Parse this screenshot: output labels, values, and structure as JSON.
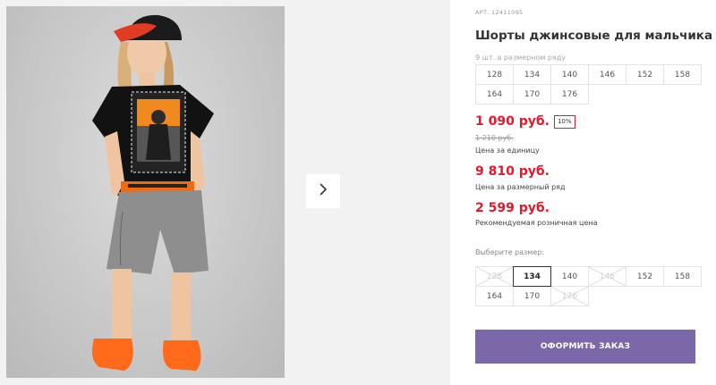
{
  "product": {
    "sku": "АРТ. 12411095",
    "title": "Шорты джинсовые для мальчика",
    "pack_note": "9 шт. в размерном ряду",
    "image_alt": "product-photo"
  },
  "pack_sizes": [
    "128",
    "134",
    "140",
    "146",
    "152",
    "158",
    "164",
    "170",
    "176"
  ],
  "prices": {
    "unit_price": "1 090 руб.",
    "discount": "10%",
    "old_price": "1 210 руб.",
    "unit_label": "Цена за единицу",
    "pack_price": "9 810 руб.",
    "pack_label": "Цена за размерный ряд",
    "rrp_price": "2 599 руб.",
    "rrp_label": "Рекомендуемая розничная цена"
  },
  "size_select": {
    "label": "Выберите размер:",
    "options": [
      {
        "value": "128",
        "state": "disabled"
      },
      {
        "value": "134",
        "state": "selected"
      },
      {
        "value": "140",
        "state": "available"
      },
      {
        "value": "146",
        "state": "disabled"
      },
      {
        "value": "152",
        "state": "available"
      },
      {
        "value": "158",
        "state": "available"
      },
      {
        "value": "164",
        "state": "available"
      },
      {
        "value": "170",
        "state": "available"
      },
      {
        "value": "176",
        "state": "disabled"
      }
    ]
  },
  "actions": {
    "order_label": "ОФОРМИТЬ ЗАКАЗ"
  },
  "colors": {
    "price_red": "#e4182b",
    "order_button": "#7b68a8"
  },
  "icons": {
    "next": "chevron-right-icon"
  }
}
